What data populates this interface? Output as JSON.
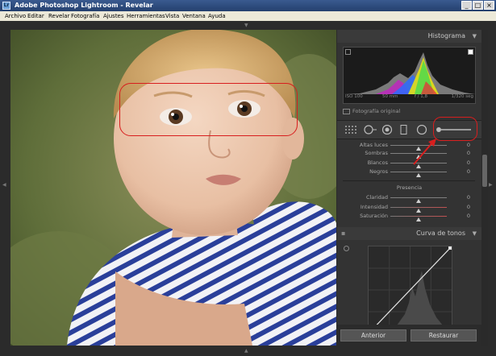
{
  "window": {
    "title": "Adobe Photoshop Lightroom - Revelar",
    "app_icon": "Lr",
    "minimize_glyph": "_",
    "maximize_glyph": "□",
    "close_glyph": "×"
  },
  "menubar": {
    "items": [
      "Archivo",
      "Editar",
      "Revelar",
      "Fotografía",
      "Ajustes",
      "Herramientas",
      "Vista",
      "Ventana",
      "Ayuda"
    ]
  },
  "histogram": {
    "title": "Histograma",
    "iso": "ISO 100",
    "focal": "50 mm",
    "aperture": "f / 1,8",
    "shutter": "1/320 seg",
    "original_label": "Fotografía original"
  },
  "basic": {
    "sliders": [
      {
        "label": "Altas luces",
        "value": "0",
        "position": 0.5
      },
      {
        "label": "Sombras",
        "value": "0",
        "position": 0.5
      },
      {
        "label": "Blancos",
        "value": "0",
        "position": 0.5
      },
      {
        "label": "Negros",
        "value": "0",
        "position": 0.5
      }
    ],
    "presence_title": "Presencia",
    "presence_sliders": [
      {
        "label": "Claridad",
        "value": "0",
        "position": 0.5
      },
      {
        "label": "Intensidad",
        "value": "0",
        "position": 0.5
      },
      {
        "label": "Saturación",
        "value": "0",
        "position": 0.5
      }
    ]
  },
  "tone_curve": {
    "title": "Curva de tonos"
  },
  "buttons": {
    "previous": "Anterior",
    "reset": "Restaurar"
  },
  "colors": {
    "annotation": "#d81e1e",
    "panel_bg": "#333333",
    "header_bg": "#3a3a3a"
  },
  "icons": [
    "grid-overlay-icon",
    "crop-icon",
    "spot-removal-icon",
    "red-eye-icon",
    "graduated-filter-icon",
    "radial-filter-icon",
    "adjustment-brush-icon",
    "point-curve-icon"
  ]
}
